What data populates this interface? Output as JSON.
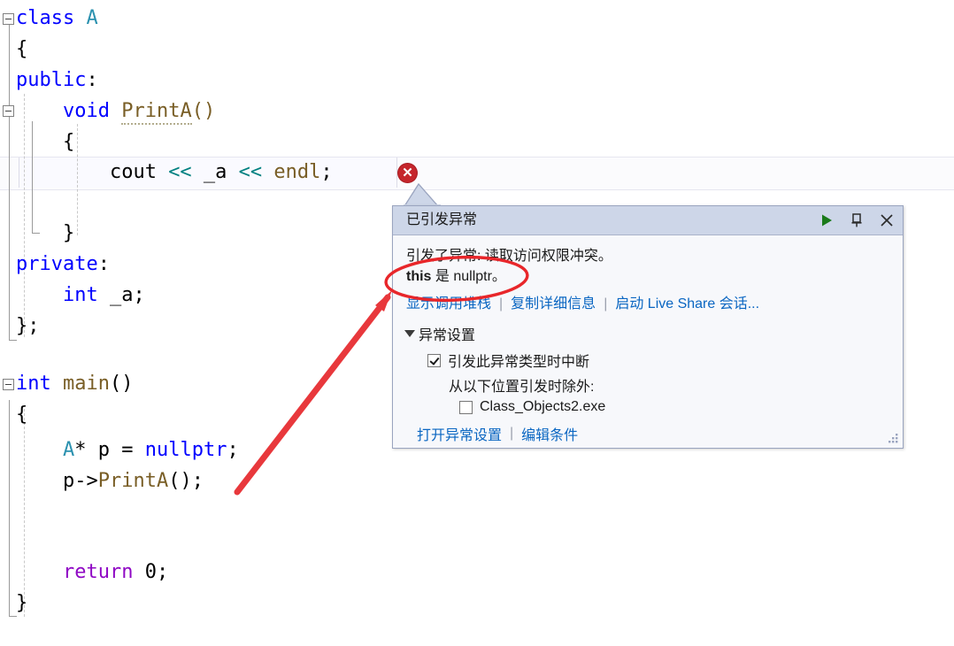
{
  "editor": {
    "language": "cpp",
    "lines": [
      {
        "indent": 0,
        "text": "class A"
      },
      {
        "indent": 0,
        "text": "{"
      },
      {
        "indent": 0,
        "text": "public:"
      },
      {
        "indent": 1,
        "text": "void PrintA()"
      },
      {
        "indent": 1,
        "text": "{"
      },
      {
        "indent": 2,
        "text": "cout << _a << endl;"
      },
      {
        "indent": 0,
        "text": ""
      },
      {
        "indent": 1,
        "text": "}"
      },
      {
        "indent": 0,
        "text": "private:"
      },
      {
        "indent": 1,
        "text": "int _a;"
      },
      {
        "indent": 0,
        "text": "};"
      },
      {
        "indent": 0,
        "text": ""
      },
      {
        "indent": 0,
        "text": "int main()"
      },
      {
        "indent": 0,
        "text": "{"
      },
      {
        "indent": 1,
        "text": "A* p = nullptr;"
      },
      {
        "indent": 1,
        "text": "p->PrintA();"
      },
      {
        "indent": 0,
        "text": ""
      },
      {
        "indent": 0,
        "text": ""
      },
      {
        "indent": 1,
        "text": "return 0;"
      },
      {
        "indent": 0,
        "text": "}"
      }
    ],
    "current_line_number": 6,
    "current_line_text": "cout << _a << endl;",
    "error_marker": "error-x-icon",
    "colors": {
      "keyword": "#0000ff",
      "type": "#2b91af",
      "function": "#795e26",
      "operator": "#008080",
      "control": "#8f08c4",
      "plain": "#000000",
      "background": "#ffffff"
    }
  },
  "popup": {
    "title": "已引发异常",
    "header_buttons": [
      {
        "name": "continue-button",
        "icon": "play-icon",
        "color": "#1a7a1a"
      },
      {
        "name": "pin-button",
        "icon": "pin-icon",
        "color": "#2b2b2b"
      },
      {
        "name": "close-button",
        "icon": "close-icon",
        "color": "#2b2b2b"
      }
    ],
    "message_line1": "引发了异常: 读取访问权限冲突。",
    "message_bold": "this",
    "message_line2_rest": " 是 nullptr。",
    "links": [
      {
        "label": "显示调用堆栈",
        "name": "show-call-stack-link"
      },
      {
        "label": "复制详细信息",
        "name": "copy-details-link"
      },
      {
        "label": "启动 Live Share 会话...",
        "name": "start-live-share-link"
      }
    ],
    "settings": {
      "section_label": "异常设置",
      "break_checkbox": {
        "label": "引发此异常类型时中断",
        "checked": true
      },
      "except_when_label": "从以下位置引发时除外:",
      "module_checkbox": {
        "label": "Class_Objects2.exe",
        "checked": false
      }
    },
    "bottom_links": [
      {
        "label": "打开异常设置",
        "name": "open-exception-settings-link"
      },
      {
        "label": "编辑条件",
        "name": "edit-conditions-link"
      }
    ],
    "link_color": "#0a66c2",
    "header_bg": "#cdd6e8",
    "body_bg": "#f7f8fb"
  },
  "annotations": {
    "ellipse_color": "#e8262a",
    "arrow_color": "#e8383c",
    "ellipse_target": "this 是 nullptr。",
    "arrow_from": "p->PrintA();",
    "arrow_to": "exception message"
  }
}
